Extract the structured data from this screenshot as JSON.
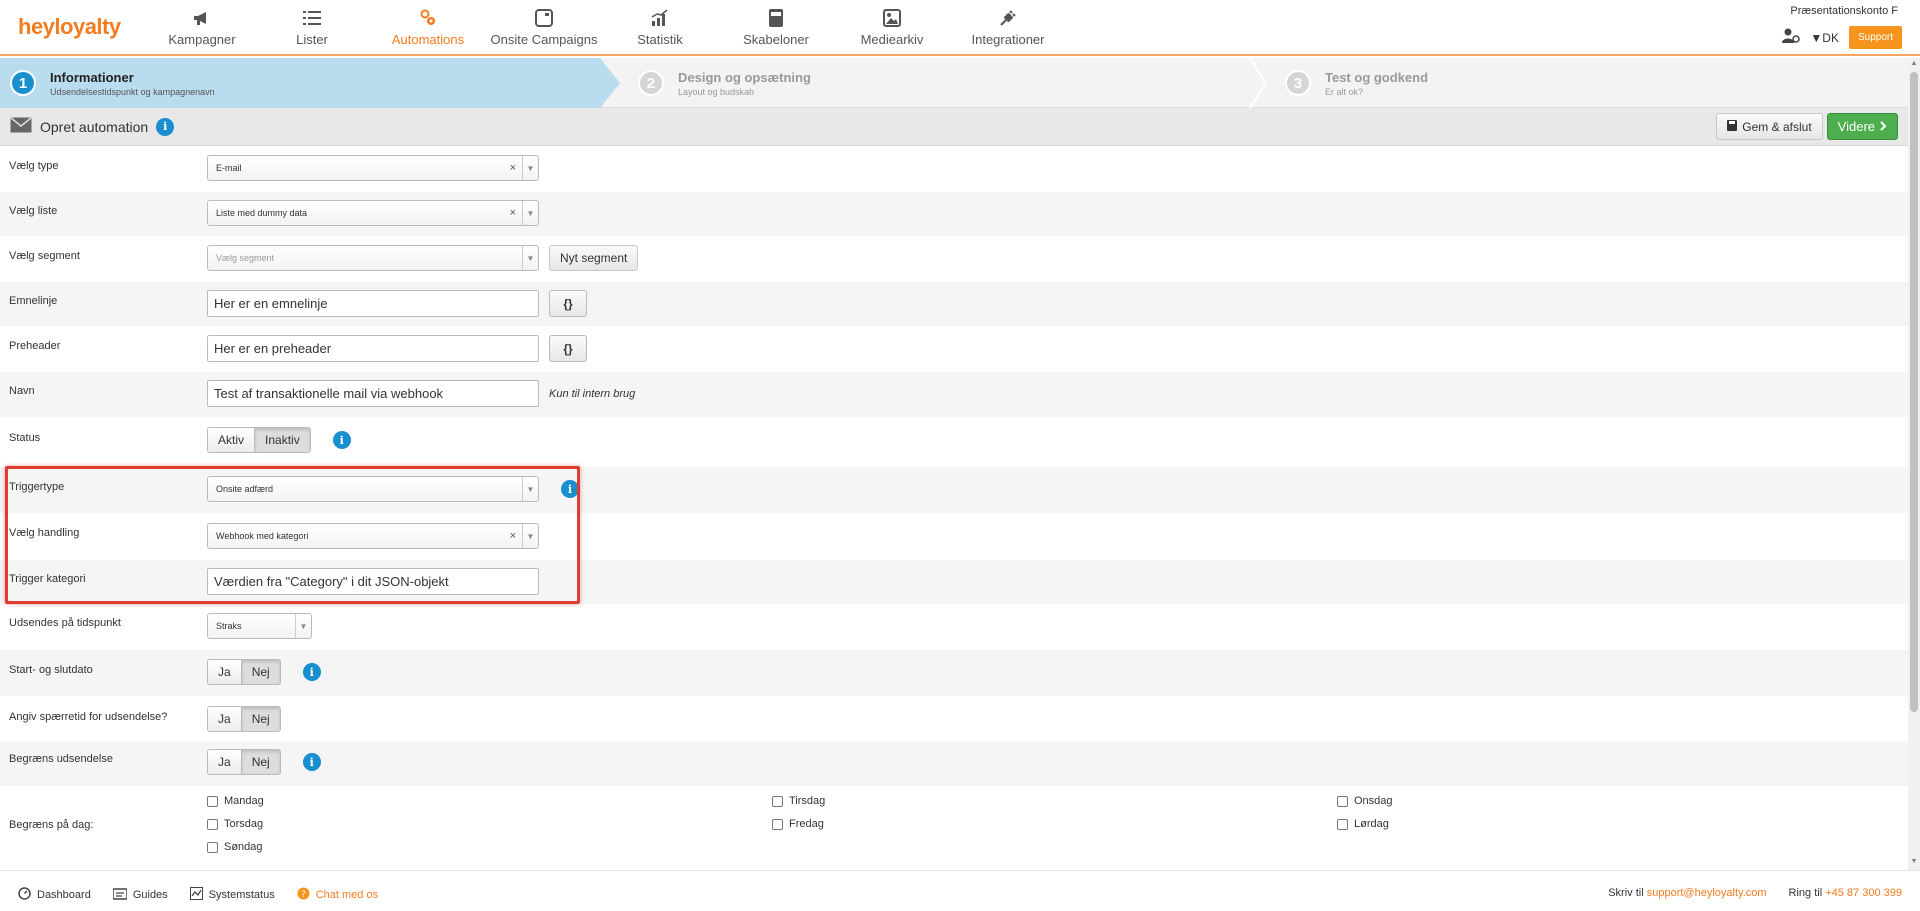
{
  "brand": {
    "logo": "heyloyalty"
  },
  "nav": [
    {
      "label": "Kampagner",
      "icon": "megaphone-icon"
    },
    {
      "label": "Lister",
      "icon": "list-icon"
    },
    {
      "label": "Automations",
      "icon": "automation-icon",
      "active": true
    },
    {
      "label": "Onsite Campaigns",
      "icon": "window-icon"
    },
    {
      "label": "Statistik",
      "icon": "chart-icon"
    },
    {
      "label": "Skabeloner",
      "icon": "template-icon"
    },
    {
      "label": "Mediearkiv",
      "icon": "image-icon"
    },
    {
      "label": "Integrationer",
      "icon": "plug-icon"
    }
  ],
  "account": {
    "name": "Præsentationskonto F",
    "lang": "▼DK",
    "support": "Support"
  },
  "wizard": [
    {
      "num": "1",
      "title": "Informationer",
      "sub": "Udsendelsestidspunkt og kampagnenavn"
    },
    {
      "num": "2",
      "title": "Design og opsætning",
      "sub": "Layout og budskab"
    },
    {
      "num": "3",
      "title": "Test og godkend",
      "sub": "Er alt ok?"
    }
  ],
  "header": {
    "title": "Opret automation",
    "save": "Gem & afslut",
    "next": "Videre"
  },
  "form": {
    "type_label": "Vælg type",
    "type_value": "E-mail",
    "list_label": "Vælg liste",
    "list_value": "Liste med dummy data",
    "segment_label": "Vælg segment",
    "segment_placeholder": "Vælg segment",
    "segment_btn": "Nyt segment",
    "subject_label": "Emnelinje",
    "subject_value": "Her er en emnelinje",
    "brace": "{}",
    "preheader_label": "Preheader",
    "preheader_value": "Her er en preheader",
    "name_label": "Navn",
    "name_value": "Test af transaktionelle mail via webhook",
    "name_note": "Kun til intern brug",
    "status_label": "Status",
    "status_on": "Aktiv",
    "status_off": "Inaktiv",
    "triggertype_label": "Triggertype",
    "triggertype_value": "Onsite adfærd",
    "action_label": "Vælg handling",
    "action_value": "Webhook med kategori",
    "trigger_cat_label": "Trigger kategori",
    "trigger_cat_value": "Værdien fra \"Category\" i dit JSON-objekt",
    "sendtime_label": "Udsendes på tidspunkt",
    "sendtime_value": "Straks",
    "startend_label": "Start- og slutdato",
    "block_label": "Angiv spærretid for udsendelse?",
    "limit_label": "Begræns udsendelse",
    "yes": "Ja",
    "no": "Nej",
    "days_label": "Begræns på dag:",
    "days": [
      "Mandag",
      "Tirsdag",
      "Onsdag",
      "Torsdag",
      "Fredag",
      "Lørdag",
      "Søndag"
    ]
  },
  "footer": {
    "dashboard": "Dashboard",
    "guides": "Guides",
    "systemstatus": "Systemstatus",
    "chat": "Chat med os",
    "write": "Skriv til",
    "email": "support@heyloyalty.com",
    "call": "Ring til",
    "phone": "+45 87 300 399"
  },
  "colors": {
    "accent": "#f47b20",
    "primary": "#1a8fd0",
    "success": "#4cae4c",
    "highlight": "#e03c31"
  }
}
